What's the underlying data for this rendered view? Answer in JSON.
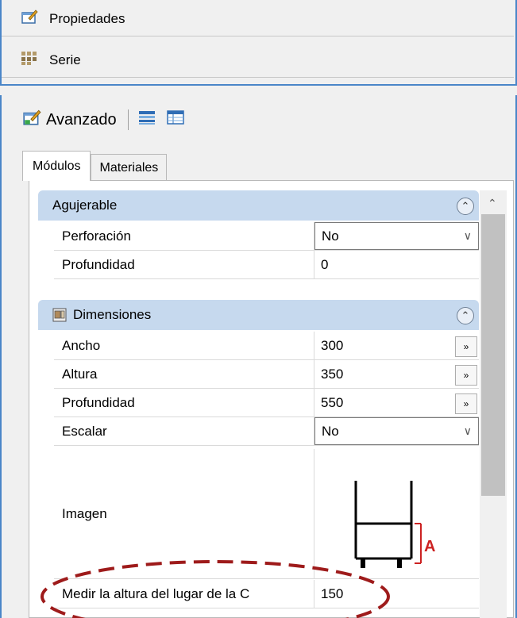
{
  "header": {
    "propiedades_label": "Propiedades",
    "serie_label": "Serie"
  },
  "toolbar": {
    "avanzado_label": "Avanzado"
  },
  "tabs": [
    {
      "label": "Módulos",
      "active": true
    },
    {
      "label": "Materiales",
      "active": false
    }
  ],
  "sections": {
    "agujerable": {
      "title": "Agujerable",
      "props": [
        {
          "name": "Perforación",
          "value": "No"
        },
        {
          "name": "Profundidad",
          "value": "0"
        }
      ]
    },
    "dimensiones": {
      "title": "Dimensiones",
      "props": [
        {
          "name": "Ancho",
          "value": "300"
        },
        {
          "name": "Altura",
          "value": "350"
        },
        {
          "name": "Profundidad",
          "value": "550"
        },
        {
          "name": "Escalar",
          "value": "No"
        }
      ],
      "image_label": "Imagen",
      "diagram_letter": "A",
      "medir": {
        "name": "Medir la altura del lugar de la C",
        "value": "150"
      }
    }
  },
  "colors": {
    "accent": "#4a86c8",
    "section_header": "#c6d9ee",
    "highlight": "#9e1b1b",
    "dimension_mark": "#cc2222"
  }
}
